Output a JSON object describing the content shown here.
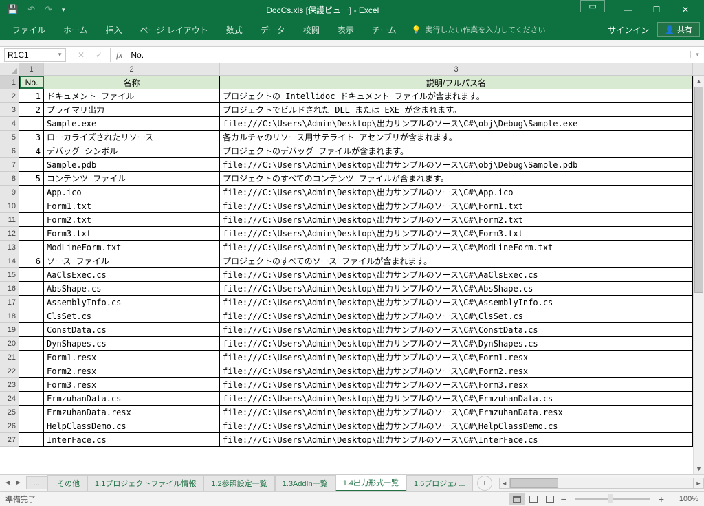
{
  "titlebar": {
    "title": "DocCs.xls  [保護ビュー] - Excel"
  },
  "ribbon": {
    "file": "ファイル",
    "home": "ホーム",
    "insert": "挿入",
    "pagelayout": "ページ レイアウト",
    "formulas": "数式",
    "data": "データ",
    "review": "校閲",
    "view": "表示",
    "team": "チーム",
    "tellme": "実行したい作業を入力してください",
    "signin": "サインイン",
    "share": "共有"
  },
  "formula": {
    "namebox": "R1C1",
    "content": "No."
  },
  "colheaders": {
    "c1": "1",
    "c2": "2",
    "c3": "3"
  },
  "table_headers": {
    "no": "No.",
    "name": "名称",
    "desc": "説明/フルパス名"
  },
  "rows": [
    {
      "r": "1",
      "no": "",
      "name": "",
      "desc": "",
      "hdr": true
    },
    {
      "r": "2",
      "no": "1",
      "name": "ドキュメント ファイル",
      "desc": "プロジェクトの Intellidoc ドキュメント ファイルが含まれます。"
    },
    {
      "r": "3",
      "no": "2",
      "name": "プライマリ出力",
      "desc": "プロジェクトでビルドされた DLL または EXE が含まれます。"
    },
    {
      "r": "4",
      "no": "",
      "name": "Sample.exe",
      "desc": "file:///C:\\Users\\Admin\\Desktop\\出力サンプルのソース\\C#\\obj\\Debug\\Sample.exe"
    },
    {
      "r": "5",
      "no": "3",
      "name": "ローカライズされたリソース",
      "desc": "各カルチャのリソース用サテライト アセンブリが含まれます。"
    },
    {
      "r": "6",
      "no": "4",
      "name": "デバッグ シンボル",
      "desc": "プロジェクトのデバッグ ファイルが含まれます。"
    },
    {
      "r": "7",
      "no": "",
      "name": "Sample.pdb",
      "desc": "file:///C:\\Users\\Admin\\Desktop\\出力サンプルのソース\\C#\\obj\\Debug\\Sample.pdb"
    },
    {
      "r": "8",
      "no": "5",
      "name": "コンテンツ ファイル",
      "desc": "プロジェクトのすべてのコンテンツ ファイルが含まれます。"
    },
    {
      "r": "9",
      "no": "",
      "name": "App.ico",
      "desc": "file:///C:\\Users\\Admin\\Desktop\\出力サンプルのソース\\C#\\App.ico"
    },
    {
      "r": "10",
      "no": "",
      "name": "Form1.txt",
      "desc": "file:///C:\\Users\\Admin\\Desktop\\出力サンプルのソース\\C#\\Form1.txt"
    },
    {
      "r": "11",
      "no": "",
      "name": "Form2.txt",
      "desc": "file:///C:\\Users\\Admin\\Desktop\\出力サンプルのソース\\C#\\Form2.txt"
    },
    {
      "r": "12",
      "no": "",
      "name": "Form3.txt",
      "desc": "file:///C:\\Users\\Admin\\Desktop\\出力サンプルのソース\\C#\\Form3.txt"
    },
    {
      "r": "13",
      "no": "",
      "name": "ModLineForm.txt",
      "desc": "file:///C:\\Users\\Admin\\Desktop\\出力サンプルのソース\\C#\\ModLineForm.txt"
    },
    {
      "r": "14",
      "no": "6",
      "name": "ソース ファイル",
      "desc": "プロジェクトのすべてのソース ファイルが含まれます。"
    },
    {
      "r": "15",
      "no": "",
      "name": "AaClsExec.cs",
      "desc": "file:///C:\\Users\\Admin\\Desktop\\出力サンプルのソース\\C#\\AaClsExec.cs"
    },
    {
      "r": "16",
      "no": "",
      "name": "AbsShape.cs",
      "desc": "file:///C:\\Users\\Admin\\Desktop\\出力サンプルのソース\\C#\\AbsShape.cs"
    },
    {
      "r": "17",
      "no": "",
      "name": "AssemblyInfo.cs",
      "desc": "file:///C:\\Users\\Admin\\Desktop\\出力サンプルのソース\\C#\\AssemblyInfo.cs"
    },
    {
      "r": "18",
      "no": "",
      "name": "ClsSet.cs",
      "desc": "file:///C:\\Users\\Admin\\Desktop\\出力サンプルのソース\\C#\\ClsSet.cs"
    },
    {
      "r": "19",
      "no": "",
      "name": "ConstData.cs",
      "desc": "file:///C:\\Users\\Admin\\Desktop\\出力サンプルのソース\\C#\\ConstData.cs"
    },
    {
      "r": "20",
      "no": "",
      "name": "DynShapes.cs",
      "desc": "file:///C:\\Users\\Admin\\Desktop\\出力サンプルのソース\\C#\\DynShapes.cs"
    },
    {
      "r": "21",
      "no": "",
      "name": "Form1.resx",
      "desc": "file:///C:\\Users\\Admin\\Desktop\\出力サンプルのソース\\C#\\Form1.resx"
    },
    {
      "r": "22",
      "no": "",
      "name": "Form2.resx",
      "desc": "file:///C:\\Users\\Admin\\Desktop\\出力サンプルのソース\\C#\\Form2.resx"
    },
    {
      "r": "23",
      "no": "",
      "name": "Form3.resx",
      "desc": "file:///C:\\Users\\Admin\\Desktop\\出力サンプルのソース\\C#\\Form3.resx"
    },
    {
      "r": "24",
      "no": "",
      "name": "FrmzuhanData.cs",
      "desc": "file:///C:\\Users\\Admin\\Desktop\\出力サンプルのソース\\C#\\FrmzuhanData.cs"
    },
    {
      "r": "25",
      "no": "",
      "name": "FrmzuhanData.resx",
      "desc": "file:///C:\\Users\\Admin\\Desktop\\出力サンプルのソース\\C#\\FrmzuhanData.resx"
    },
    {
      "r": "26",
      "no": "",
      "name": "HelpClassDemo.cs",
      "desc": "file:///C:\\Users\\Admin\\Desktop\\出力サンプルのソース\\C#\\HelpClassDemo.cs"
    },
    {
      "r": "27",
      "no": "",
      "name": "InterFace.cs",
      "desc": "file:///C:\\Users\\Admin\\Desktop\\出力サンプルのソース\\C#\\InterFace.cs"
    }
  ],
  "sheets": {
    "more": "...",
    "other": ".その他",
    "s11": "1.1プロジェクトファイル情報",
    "s12": "1.2参照設定一覧",
    "s13": "1.3AddIn一覧",
    "s14": "1.4出力形式一覧",
    "s15": "1.5プロジェ/ ..."
  },
  "statusbar": {
    "ready": "準備完了",
    "zoom": "100%"
  }
}
